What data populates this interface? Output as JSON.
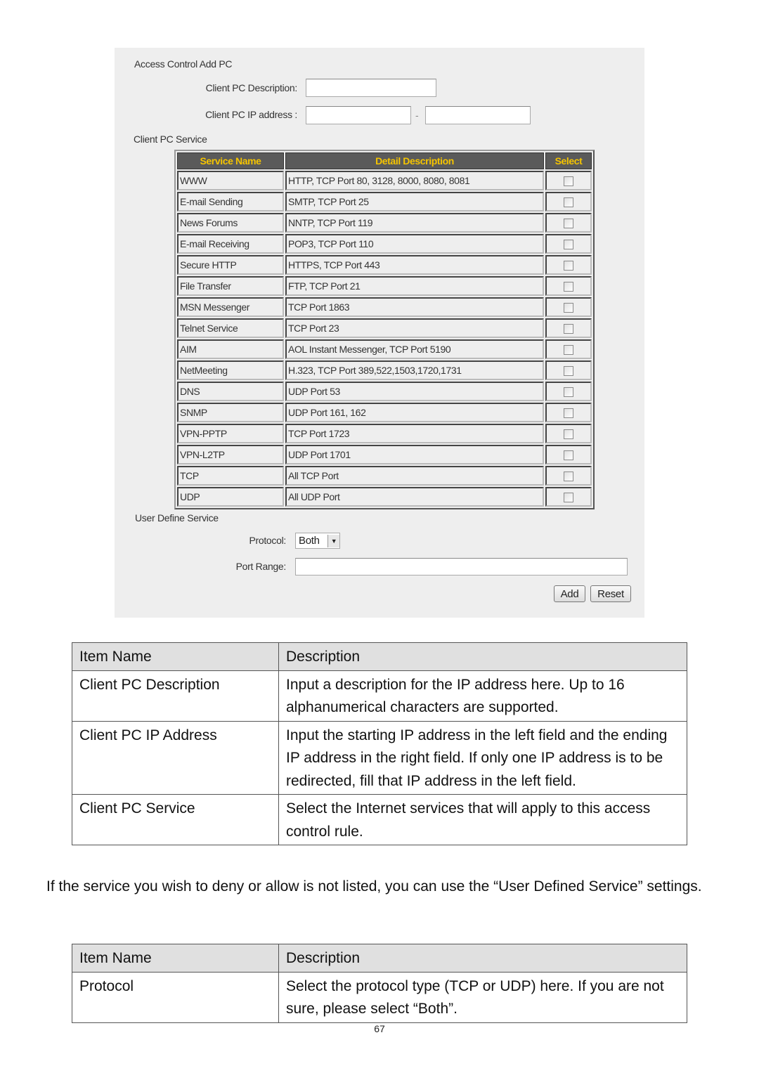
{
  "screenshot": {
    "title": "Access Control Add PC",
    "client_pc_description_label": "Client PC Description:",
    "client_pc_description_value": "",
    "client_pc_ip_label": "Client PC IP address :",
    "ip_start_value": "",
    "ip_separator": "-",
    "ip_end_value": "",
    "client_pc_service_title": "Client PC Service",
    "service_table": {
      "headers": [
        "Service Name",
        "Detail Description",
        "Select"
      ],
      "rows": [
        {
          "name": "WWW",
          "detail": "HTTP, TCP Port 80, 3128, 8000, 8080, 8081",
          "checked": false
        },
        {
          "name": "E-mail Sending",
          "detail": "SMTP, TCP Port 25",
          "checked": false
        },
        {
          "name": "News Forums",
          "detail": "NNTP, TCP Port 119",
          "checked": false
        },
        {
          "name": "E-mail Receiving",
          "detail": "POP3, TCP Port 110",
          "checked": false
        },
        {
          "name": "Secure HTTP",
          "detail": "HTTPS, TCP Port 443",
          "checked": false
        },
        {
          "name": "File Transfer",
          "detail": "FTP, TCP Port 21",
          "checked": false
        },
        {
          "name": "MSN Messenger",
          "detail": "TCP Port 1863",
          "checked": false
        },
        {
          "name": "Telnet Service",
          "detail": "TCP Port 23",
          "checked": false
        },
        {
          "name": "AIM",
          "detail": "AOL Instant Messenger, TCP Port 5190",
          "checked": false
        },
        {
          "name": "NetMeeting",
          "detail": "H.323, TCP Port 389,522,1503,1720,1731",
          "checked": false
        },
        {
          "name": "DNS",
          "detail": "UDP Port 53",
          "checked": false
        },
        {
          "name": "SNMP",
          "detail": "UDP Port 161, 162",
          "checked": false
        },
        {
          "name": "VPN-PPTP",
          "detail": "TCP Port 1723",
          "checked": false
        },
        {
          "name": "VPN-L2TP",
          "detail": "UDP Port 1701",
          "checked": false
        },
        {
          "name": "TCP",
          "detail": "All TCP Port",
          "checked": false
        },
        {
          "name": "UDP",
          "detail": "All UDP Port",
          "checked": false
        }
      ]
    },
    "user_define_service_title": "User Define Service",
    "protocol_label": "Protocol:",
    "protocol_value": "Both",
    "port_range_label": "Port Range:",
    "port_range_value": "",
    "add_button": "Add",
    "reset_button": "Reset",
    "colors": {
      "header_bg": "#5a5a5a",
      "header_text": "#f5c400",
      "panel_bg": "#eeeeee"
    }
  },
  "table1": {
    "headers": [
      "Item Name",
      "Description"
    ],
    "rows": [
      {
        "item": "Client PC Description",
        "description": "Input a description for the IP address here. Up to 16 alphanumerical characters are supported."
      },
      {
        "item": "Client PC IP Address",
        "description": "Input the starting IP address in the left field and the ending IP address in the right field. If only one IP address is to be redirected, fill that IP address in the left field."
      },
      {
        "item": "Client PC Service",
        "description": "Select the Internet services that will apply to this access control rule."
      }
    ]
  },
  "paragraph": "If the service you wish to deny or allow is not listed, you can use the “User Defined Service” settings.",
  "table2": {
    "headers": [
      "Item Name",
      "Description"
    ],
    "rows": [
      {
        "item": "Protocol",
        "description": "Select the protocol type (TCP or UDP) here. If you are not sure, please select “Both”."
      }
    ]
  },
  "page_number": "67"
}
